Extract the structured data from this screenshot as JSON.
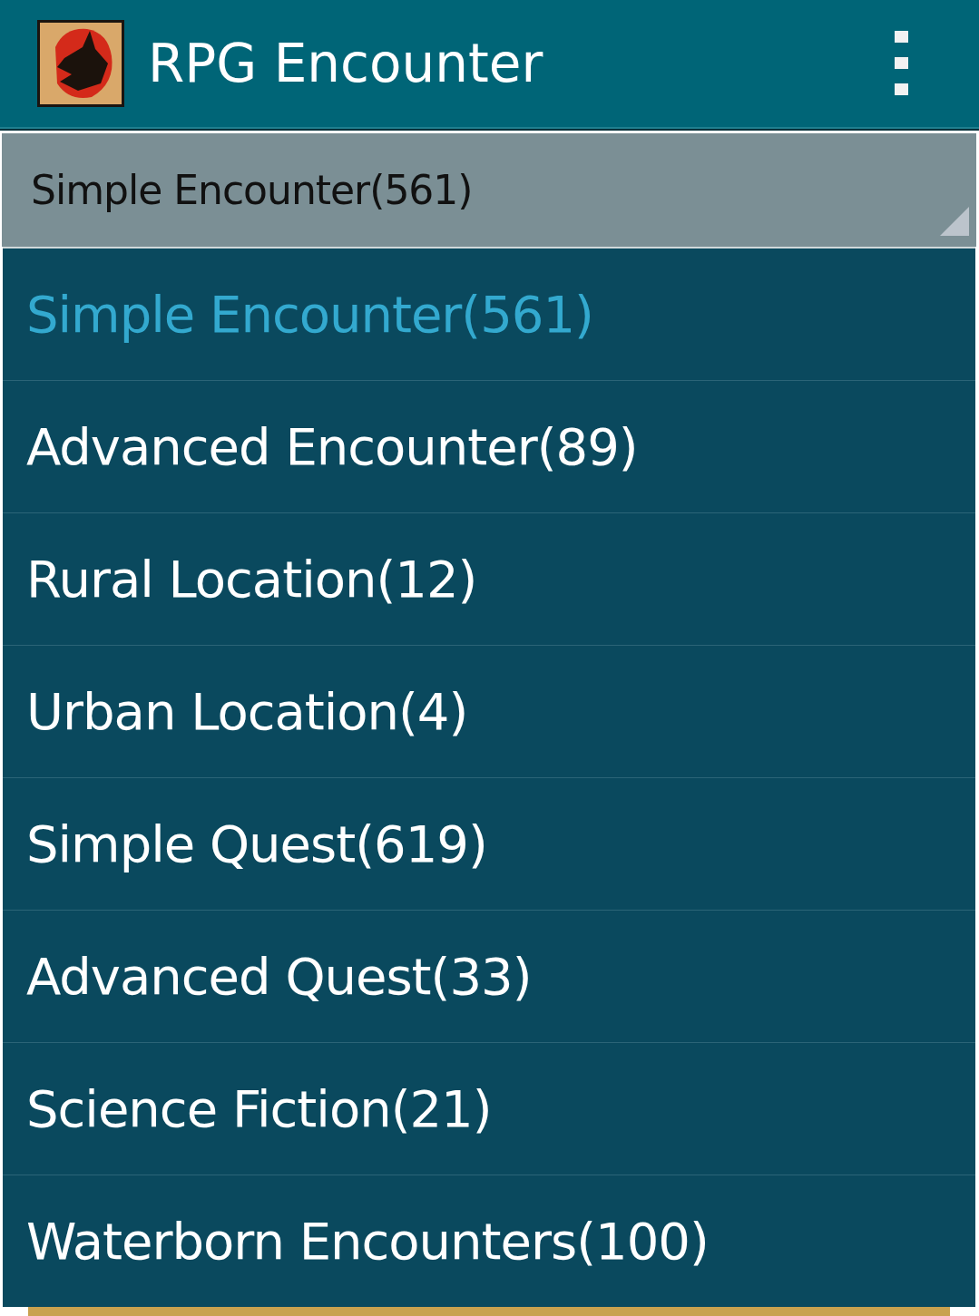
{
  "app_bar": {
    "title": "RPG Encounter"
  },
  "spinner": {
    "value": "Simple Encounter(561)"
  },
  "dropdown": {
    "options": [
      {
        "label": "Simple Encounter(561)",
        "selected": true
      },
      {
        "label": "Advanced Encounter(89)",
        "selected": false
      },
      {
        "label": "Rural Location(12)",
        "selected": false
      },
      {
        "label": "Urban Location(4)",
        "selected": false
      },
      {
        "label": "Simple Quest(619)",
        "selected": false
      },
      {
        "label": "Advanced Quest(33)",
        "selected": false
      },
      {
        "label": "Science Fiction(21)",
        "selected": false
      },
      {
        "label": "Waterborn Encounters(100)",
        "selected": false
      }
    ]
  }
}
